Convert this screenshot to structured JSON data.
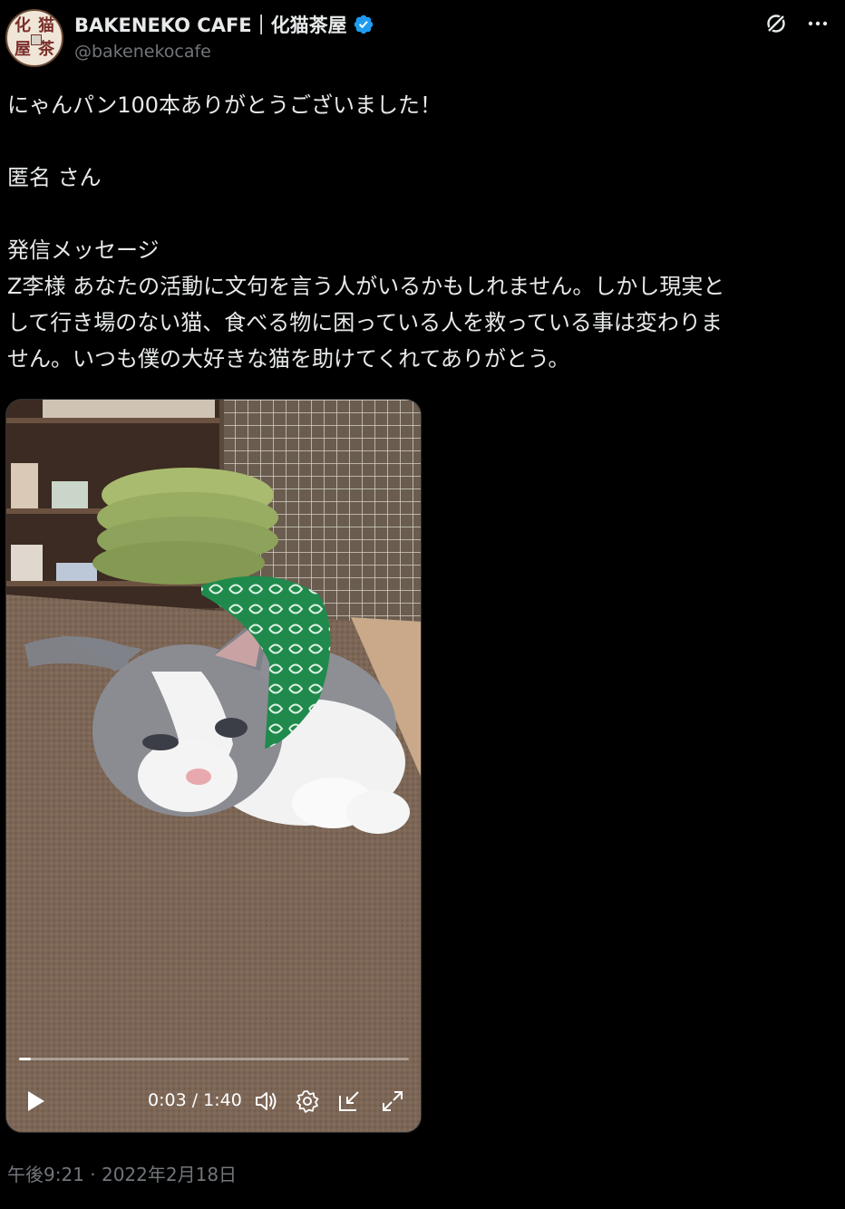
{
  "header": {
    "display_name": "BAKENEKO CAFE｜化猫茶屋",
    "handle": "@bakenekocafe",
    "avatar_chars": [
      "化",
      "猫",
      "屋",
      "茶"
    ],
    "verified_color": "#1d9bf0"
  },
  "tweet": {
    "lines": [
      "にゃんパン100本ありがとうございました！",
      "",
      "匿名 さん",
      "",
      "発信メッセージ",
      "Z李様 あなたの活動に文句を言う人がいるかもしれません。しかし現実と",
      "して行き場のない猫、食べる物に困っている人を救っている事は変わりま",
      "せん。いつも僕の大好きな猫を助けてくれてありがとう。"
    ]
  },
  "video": {
    "time": "0:03 / 1:40",
    "progress": 0.03,
    "icons": [
      "play-icon",
      "volume-icon",
      "settings-icon",
      "pip-icon",
      "fullscreen-icon"
    ]
  },
  "timestamp": "午後9:21 · 2022年2月18日",
  "colors": {
    "background": "#000000",
    "text": "#e7e9ea",
    "muted": "#71767b"
  }
}
